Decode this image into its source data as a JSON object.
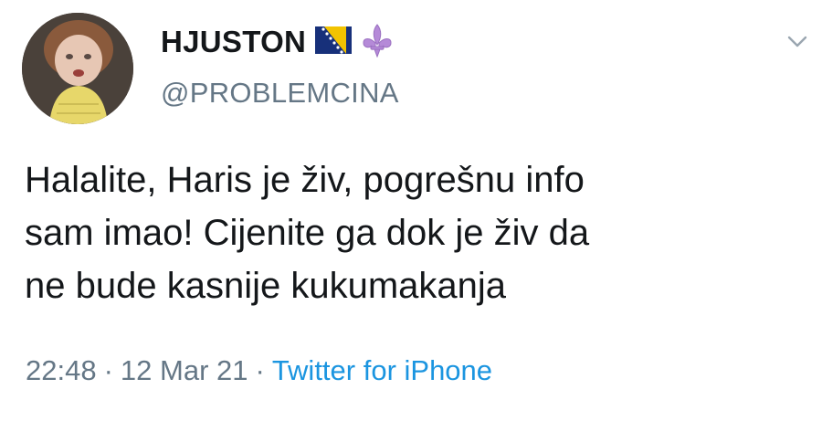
{
  "user": {
    "display_name": "HJUSTON",
    "handle": "@PROBLEMCINA",
    "badges": [
      "bosnia-flag-icon",
      "fleur-de-lis-icon"
    ]
  },
  "tweet": {
    "line1": "Halalite, Haris je živ, pogrešnu info",
    "line2": "sam imao! Cijenite ga dok je živ da",
    "line3": "ne bude kasnije kukumakanja"
  },
  "meta": {
    "time": "22:48",
    "sep1": "·",
    "date": "12 Mar 21",
    "sep2": "·",
    "source": "Twitter for iPhone"
  },
  "colors": {
    "text": "#14171a",
    "secondary": "#657786",
    "link": "#1b95e0"
  }
}
